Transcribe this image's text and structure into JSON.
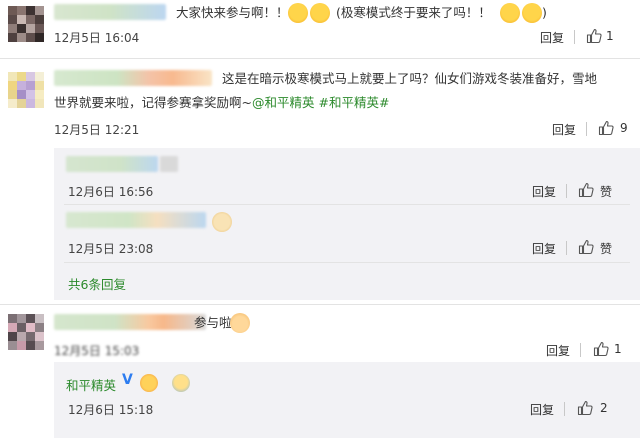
{
  "comments": [
    {
      "text": "大家快来参与啊！！",
      "text_after": "(极寒模式终于要来了吗！！",
      "time": "12月5日 16:04",
      "reply_label": "回复",
      "likes": "1"
    },
    {
      "text_line1": "这是在暗示极寒模式马上就要上了吗？仙女们游戏冬装准备好，雪地",
      "text_line2": "世界就要来啦，记得参赛拿奖励啊~",
      "mention": "@和平精英",
      "topic": "#和平精英#",
      "time": "12月5日 12:21",
      "reply_label": "回复",
      "likes": "9"
    },
    {
      "text_after": "参与啦",
      "time": "12月5日 15:03",
      "reply_label": "回复",
      "likes": "1"
    }
  ],
  "replies": [
    {
      "time": "12月6日 16:56",
      "reply_label": "回复",
      "like_label": "赞"
    },
    {
      "time": "12月5日 23:08",
      "reply_label": "回复",
      "like_label": "赞"
    }
  ],
  "more_replies": "共6条回复",
  "official_reply": {
    "name": "和平精英",
    "time": "12月6日 15:18",
    "reply_label": "回复",
    "likes": "2"
  },
  "colors": {
    "link_green": "#2c8a2c",
    "reply_bg": "#f2f2f5",
    "verified_blue": "#2d7df0"
  }
}
